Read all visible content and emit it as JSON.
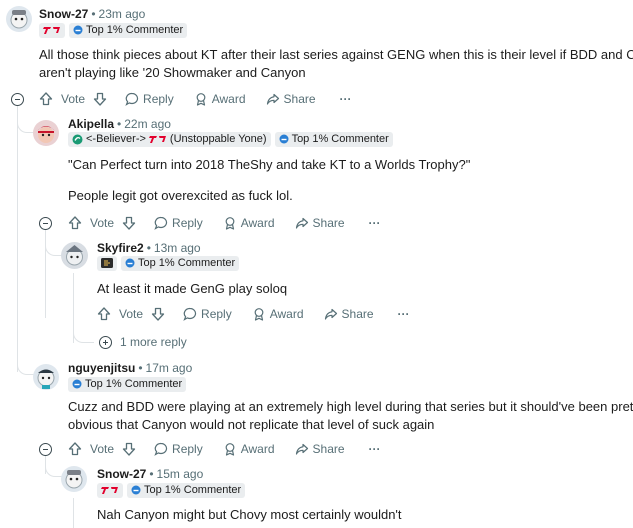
{
  "comments": [
    {
      "author": "Snow-27",
      "time": "23m ago",
      "flair": "Top 1% Commenter",
      "body": [
        "All those think pieces about KT after their last series against GENG when this is their level if BDD and Cuzz",
        "aren't playing like '20 Showmaker and Canyon"
      ]
    },
    {
      "author": "Akipella",
      "time": "22m ago",
      "team_flair": "<-Believer->",
      "team_flair_suffix": "(Unstoppable Yone)",
      "flair": "Top 1% Commenter",
      "body": [
        "\"Can Perfect turn into 2018 TheShy and take KT to a Worlds Trophy?\"",
        "People legit got overexcited as fuck lol."
      ]
    },
    {
      "author": "Skyfire2",
      "time": "13m ago",
      "flair": "Top 1% Commenter",
      "body": [
        "At least it made GenG play soloq"
      ],
      "more_replies": "1 more reply"
    },
    {
      "author": "nguyenjitsu",
      "time": "17m ago",
      "flair": "Top 1% Commenter",
      "body": [
        "Cuzz and BDD were playing at an extremely high level during that series but it should've been pretty",
        "obvious that Canyon would not replicate that level of suck again"
      ]
    },
    {
      "author": "Snow-27",
      "time": "15m ago",
      "flair": "Top 1% Commenter",
      "body": [
        "Nah Canyon might but Chovy most certainly wouldn't"
      ]
    }
  ],
  "actions": {
    "vote": "Vote",
    "reply": "Reply",
    "award": "Award",
    "share": "Share",
    "more": "···"
  },
  "separator": "•",
  "colors": {
    "text": "#1c1c1c",
    "meta": "#576f76",
    "thread_line": "#dfe3e6",
    "flair_bg": "#eaedef",
    "t1_red": "#e2012d",
    "collapse_icon": "#3b4a50"
  },
  "icons": [
    "t1-logo-icon",
    "gen-g-logo-icon",
    "believer-logo-icon",
    "top-commenter-badge-icon",
    "upvote-icon",
    "downvote-icon",
    "reply-icon",
    "award-icon",
    "share-icon",
    "overflow-icon",
    "collapse-icon",
    "expand-icon"
  ]
}
